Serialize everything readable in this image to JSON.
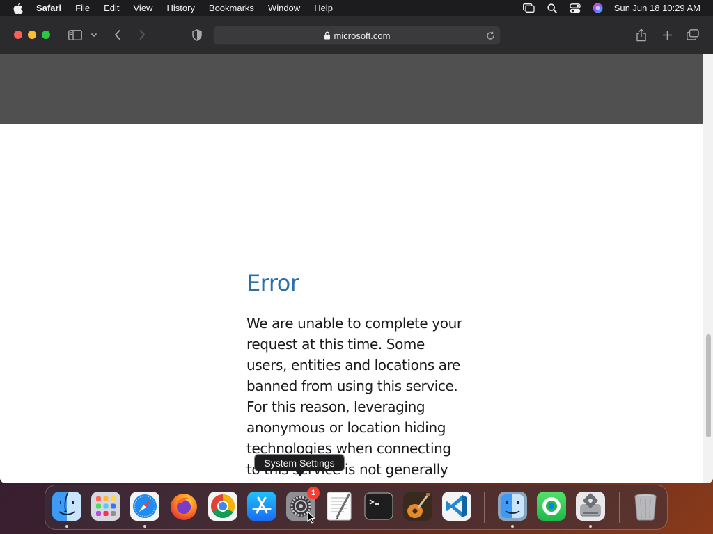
{
  "menubar": {
    "apple_icon": "apple-logo-icon",
    "app_name": "Safari",
    "items": [
      "File",
      "Edit",
      "View",
      "History",
      "Bookmarks",
      "Window",
      "Help"
    ],
    "clock": "Sun Jun 18  10:29 AM",
    "status_icons": [
      "display-mirroring-icon",
      "spotlight-search-icon",
      "control-center-icon",
      "siri-icon"
    ]
  },
  "browser": {
    "address": "microsoft.com",
    "toolbar_icons": [
      "sidebar-icon",
      "chevron-down-icon",
      "back-arrow-icon",
      "forward-arrow-icon",
      "privacy-shield-icon",
      "lock-icon",
      "reload-icon",
      "share-icon",
      "new-tab-icon",
      "tab-overview-icon"
    ]
  },
  "page": {
    "error_title": "Error",
    "error_body": "We are unable to complete your request at this time. Some users, entities and locations are banned from using this service. For this reason, leveraging anonymous or location hiding technologies when connecting to this service is not generally allowed. If you"
  },
  "tooltip": {
    "text": "System Settings"
  },
  "dock": {
    "apps": [
      {
        "name": "Finder",
        "running": true
      },
      {
        "name": "Launchpad",
        "running": false
      },
      {
        "name": "Safari",
        "running": true
      },
      {
        "name": "Firefox",
        "running": false
      },
      {
        "name": "Google Chrome",
        "running": false
      },
      {
        "name": "App Store",
        "running": false
      },
      {
        "name": "System Settings",
        "running": false,
        "badge": "1"
      },
      {
        "name": "TextEdit",
        "running": false
      },
      {
        "name": "Terminal",
        "running": false
      },
      {
        "name": "GarageBand",
        "running": false
      },
      {
        "name": "Visual Studio Code",
        "running": false
      },
      {
        "name": "Finder Alt",
        "running": true
      },
      {
        "name": "Find My",
        "running": false
      },
      {
        "name": "Disk Utility",
        "running": true
      },
      {
        "name": "Trash",
        "running": false
      }
    ]
  },
  "colors": {
    "error_title": "#2c6fa8",
    "banner": "#505050",
    "menubar": "#1c1c1e",
    "toolbar": "#2b2b2d"
  }
}
